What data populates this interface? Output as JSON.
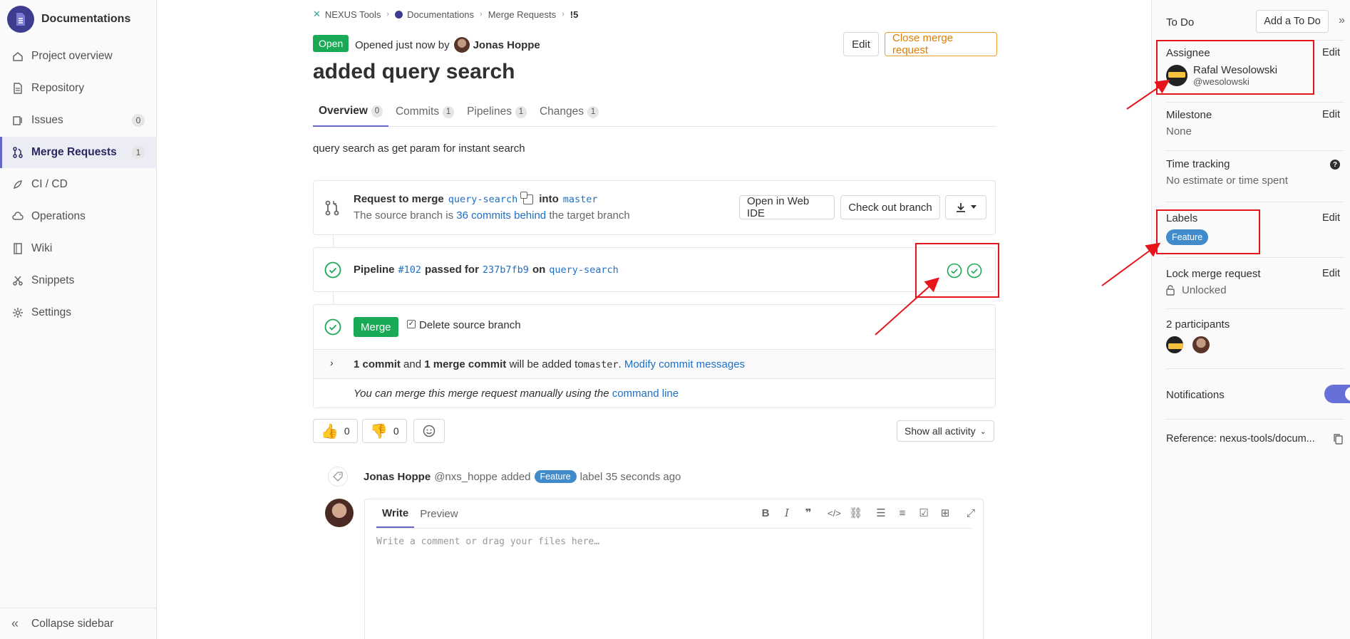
{
  "sidebar": {
    "project_name": "Documentations",
    "items": [
      {
        "label": "Project overview",
        "badge": ""
      },
      {
        "label": "Repository",
        "badge": ""
      },
      {
        "label": "Issues",
        "badge": "0"
      },
      {
        "label": "Merge Requests",
        "badge": "1"
      },
      {
        "label": "CI / CD",
        "badge": ""
      },
      {
        "label": "Operations",
        "badge": ""
      },
      {
        "label": "Wiki",
        "badge": ""
      },
      {
        "label": "Snippets",
        "badge": ""
      },
      {
        "label": "Settings",
        "badge": ""
      }
    ],
    "collapse_label": "Collapse sidebar"
  },
  "breadcrumb": [
    "NEXUS Tools",
    "Documentations",
    "Merge Requests",
    "!5"
  ],
  "header": {
    "status": "Open",
    "opened_text": "Opened just now by",
    "author": "Jonas Hoppe",
    "edit_label": "Edit",
    "close_label": "Close merge request",
    "title": "added query search"
  },
  "tabs": [
    {
      "label": "Overview",
      "count": "0"
    },
    {
      "label": "Commits",
      "count": "1"
    },
    {
      "label": "Pipelines",
      "count": "1"
    },
    {
      "label": "Changes",
      "count": "1"
    }
  ],
  "description": "query search as get param for instant search",
  "merge_request": {
    "request_label": "Request to merge",
    "source_branch": "query-search",
    "into_label": "into",
    "target_branch": "master",
    "behind_prefix": "The source branch is",
    "behind_link": "36 commits behind",
    "behind_suffix": "the target branch",
    "open_ide": "Open in Web IDE",
    "checkout": "Check out branch"
  },
  "pipeline": {
    "label": "Pipeline",
    "id": "#102",
    "passed": "passed for",
    "commit": "237b7fb9",
    "on": "on",
    "branch": "query-search"
  },
  "merge": {
    "button": "Merge",
    "delete_source": "Delete source branch",
    "commit_count": "1 commit",
    "and": "and",
    "merge_commit": "1 merge commit",
    "added_to": "will be added to",
    "target": "master",
    "period": ".",
    "modify_link": "Modify commit messages",
    "manual_text": "You can merge this merge request manually using the",
    "cmd_link": "command line"
  },
  "reactions": {
    "thumbs_up": "0",
    "thumbs_down": "0",
    "show_activity": "Show all activity"
  },
  "activity": {
    "author": "Jonas Hoppe",
    "handle": "@nxs_hoppe",
    "action": "added",
    "label": "Feature",
    "suffix": "label 35 seconds ago"
  },
  "editor": {
    "write_tab": "Write",
    "preview_tab": "Preview",
    "placeholder": "Write a comment or drag your files here…"
  },
  "right_sidebar": {
    "todo_label": "To Do",
    "add_todo": "Add a To Do",
    "assignee_title": "Assignee",
    "assignee_name": "Rafal Wesolowski",
    "assignee_handle": "@wesolowski",
    "milestone_title": "Milestone",
    "milestone_value": "None",
    "time_title": "Time tracking",
    "time_value": "No estimate or time spent",
    "labels_title": "Labels",
    "label_value": "Feature",
    "lock_title": "Lock merge request",
    "lock_value": "Unlocked",
    "participants_title": "2 participants",
    "notifications_title": "Notifications",
    "notifications_on": true,
    "reference": "Reference: nexus-tools/docum...",
    "edit_label": "Edit"
  },
  "colors": {
    "accent": "#6666c4",
    "success": "#1aaa55",
    "warning": "#de7e00",
    "label": "#428bca",
    "annotation": "#e8141b"
  }
}
